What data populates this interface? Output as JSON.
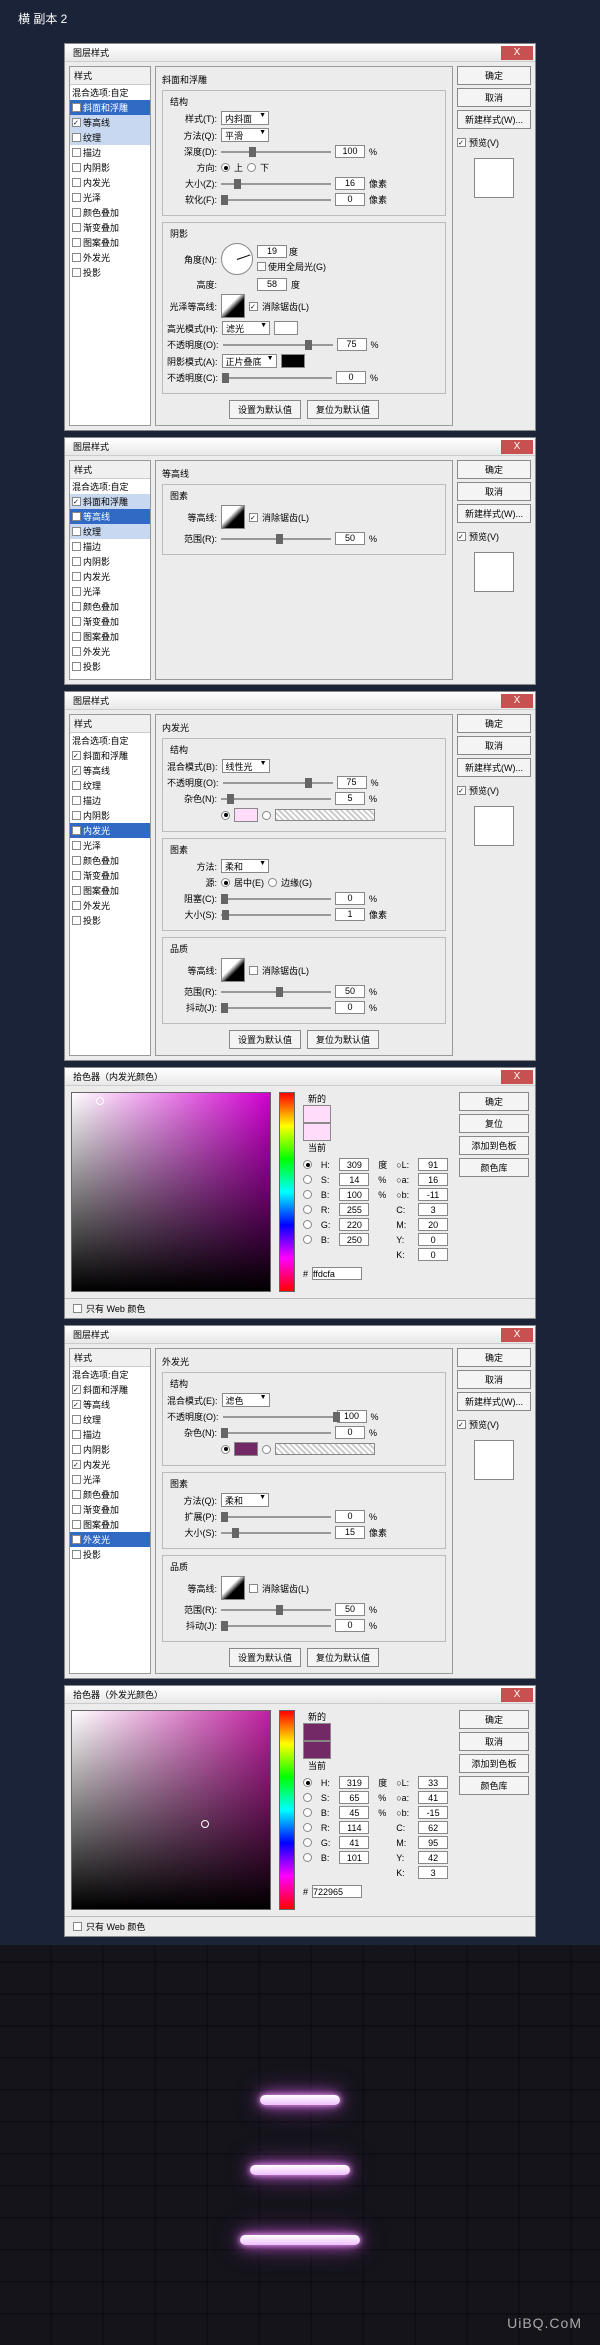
{
  "header": "横 副本 2",
  "dlg_title": "图层样式",
  "close_x": "X",
  "styles_header": "样式",
  "blend_opts": "混合选项:自定",
  "styles_list": [
    "斜面和浮雕",
    "等高线",
    "纹理",
    "描边",
    "内阴影",
    "内发光",
    "光泽",
    "颜色叠加",
    "渐变叠加",
    "图案叠加",
    "外发光",
    "投影"
  ],
  "btns": {
    "ok": "确定",
    "cancel": "取消",
    "newstyle": "新建样式(W)...",
    "preview": "预览(V)",
    "default1": "设置为默认值",
    "default2": "复位为默认值"
  },
  "panel1": {
    "title": "斜面和浮雕",
    "struct": "结构",
    "style_l": "样式(T):",
    "style_v": "内斜面",
    "tech_l": "方法(Q):",
    "tech_v": "平滑",
    "depth_l": "深度(D):",
    "depth_v": "100",
    "pct": "%",
    "dir_l": "方向:",
    "dir_up": "上",
    "dir_dn": "下",
    "size_l": "大小(Z):",
    "size_v": "16",
    "px": "像素",
    "soften_l": "软化(F):",
    "soften_v": "0",
    "shading": "阴影",
    "angle_l": "角度(N):",
    "angle_v": "19",
    "deg": "度",
    "global": "使用全局光(G)",
    "alt_l": "高度:",
    "alt_v": "58",
    "gloss_l": "光泽等高线:",
    "anti": "消除锯齿(L)",
    "hl_mode_l": "高光模式(H):",
    "hl_mode_v": "滤光",
    "hl_op_l": "不透明度(O):",
    "hl_op_v": "75",
    "sh_mode_l": "阴影模式(A):",
    "sh_mode_v": "正片叠底",
    "sh_op_l": "不透明度(C):",
    "sh_op_v": "0"
  },
  "panel2": {
    "title": "等高线",
    "elem": "图素",
    "contour_l": "等高线:",
    "anti": "消除锯齿(L)",
    "range_l": "范围(R):",
    "range_v": "50",
    "pct": "%"
  },
  "panel3": {
    "title": "内发光",
    "struct": "结构",
    "blend_l": "混合模式(B):",
    "blend_v": "线性光",
    "op_l": "不透明度(O):",
    "op_v": "75",
    "pct": "%",
    "noise_l": "杂色(N):",
    "noise_v": "5",
    "elem": "图素",
    "tech_l": "方法:",
    "tech_v": "柔和",
    "src_l": "源:",
    "src_c": "居中(E)",
    "src_e": "边缘(G)",
    "choke_l": "阻塞(C):",
    "choke_v": "0",
    "size_l": "大小(S):",
    "size_v": "1",
    "px": "像素",
    "quality": "品质",
    "contour_l": "等高线:",
    "anti": "消除锯齿(L)",
    "range_l": "范围(R):",
    "range_v": "50",
    "jitter_l": "抖动(J):",
    "jitter_v": "0"
  },
  "cp1": {
    "title": "拾色器（内发光颜色）",
    "new": "新的",
    "cur": "当前",
    "H": "309",
    "S": "14",
    "B": "100",
    "R": "255",
    "G": "220",
    "Bc": "250",
    "L": "91",
    "a": "16",
    "bb": "-11",
    "C": "3",
    "M": "20",
    "Y": "0",
    "K": "0",
    "hex": "ffdcfa",
    "btns": {
      "ok": "确定",
      "cancel": "复位",
      "add": "添加到色板",
      "lib": "颜色库"
    },
    "webonly": "只有 Web 颜色"
  },
  "panel4": {
    "title": "外发光",
    "struct": "结构",
    "blend_l": "混合模式(E):",
    "blend_v": "滤色",
    "op_l": "不透明度(O):",
    "op_v": "100",
    "pct": "%",
    "noise_l": "杂色(N):",
    "noise_v": "0",
    "elem": "图素",
    "tech_l": "方法(Q):",
    "tech_v": "柔和",
    "spread_l": "扩展(P):",
    "spread_v": "0",
    "size_l": "大小(S):",
    "size_v": "15",
    "px": "像素",
    "quality": "品质",
    "contour_l": "等高线:",
    "anti": "消除锯齿(L)",
    "range_l": "范围(R):",
    "range_v": "50",
    "jitter_l": "抖动(J):",
    "jitter_v": "0"
  },
  "cp2": {
    "title": "拾色器（外发光颜色）",
    "new": "新的",
    "cur": "当前",
    "H": "319",
    "S": "65",
    "B": "45",
    "R": "114",
    "G": "41",
    "Bc": "101",
    "L": "33",
    "a": "41",
    "bb": "-15",
    "C": "62",
    "M": "95",
    "Y": "42",
    "K": "3",
    "hex": "722965",
    "btns": {
      "ok": "确定",
      "cancel": "取消",
      "add": "添加到色板",
      "lib": "颜色库"
    },
    "webonly": "只有 Web 颜色"
  },
  "watermark": "UiBQ.CoM"
}
